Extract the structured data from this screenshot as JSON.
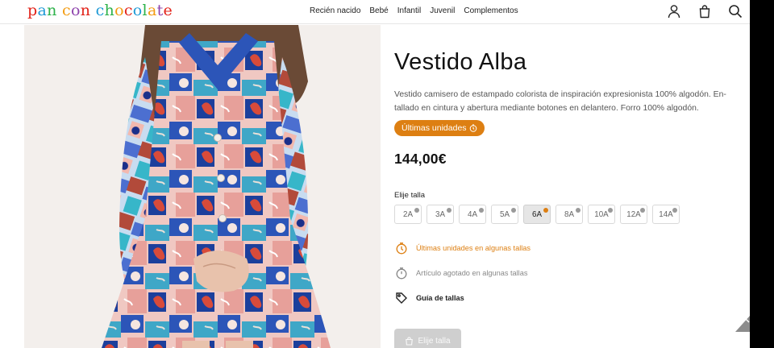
{
  "header": {
    "logo_text": "pan con chocolate",
    "nav": [
      "Recién nacido",
      "Bebé",
      "Infantil",
      "Juvenil",
      "Complementos"
    ],
    "icons": [
      "user-icon",
      "bag-icon",
      "search-icon"
    ]
  },
  "product": {
    "title": "Vestido Alba",
    "description": "Vestido camisero de estampado colorista de inspiración expresionista 100% algodón. En-tallado en cintura y abertura mediante botones en delantero. Forro 100% algodón.",
    "badge": "Últimas unidades",
    "price": "144,00€",
    "size_label": "Elije talla",
    "sizes": [
      {
        "label": "2A",
        "indicator": "grey"
      },
      {
        "label": "3A",
        "indicator": "grey"
      },
      {
        "label": "4A",
        "indicator": "grey"
      },
      {
        "label": "5A",
        "indicator": "grey"
      },
      {
        "label": "6A",
        "indicator": "orange",
        "selected": true
      },
      {
        "label": "8A",
        "indicator": "grey"
      },
      {
        "label": "10A",
        "indicator": "grey"
      },
      {
        "label": "12A",
        "indicator": "grey"
      },
      {
        "label": "14A",
        "indicator": "grey"
      }
    ],
    "notes": {
      "last_units": "Últimas unidades en algunas tallas",
      "sold_out": "Artículo agotado en algunas tallas",
      "size_guide": "Guía de tallas"
    },
    "choose_button": "Elije talla"
  },
  "colors": {
    "accent": "#dd7f12",
    "logo_letters": [
      "#e2231a",
      "#1e9ad6",
      "#2db24a",
      "#f39c12",
      "#8e44ad",
      "#e2231a",
      "#1e9ad6",
      "#2db24a",
      "#f39c12",
      "#e2231a",
      "#1e9ad6",
      "#2db24a",
      "#f39c12",
      "#8e44ad",
      "#e2231a"
    ]
  }
}
